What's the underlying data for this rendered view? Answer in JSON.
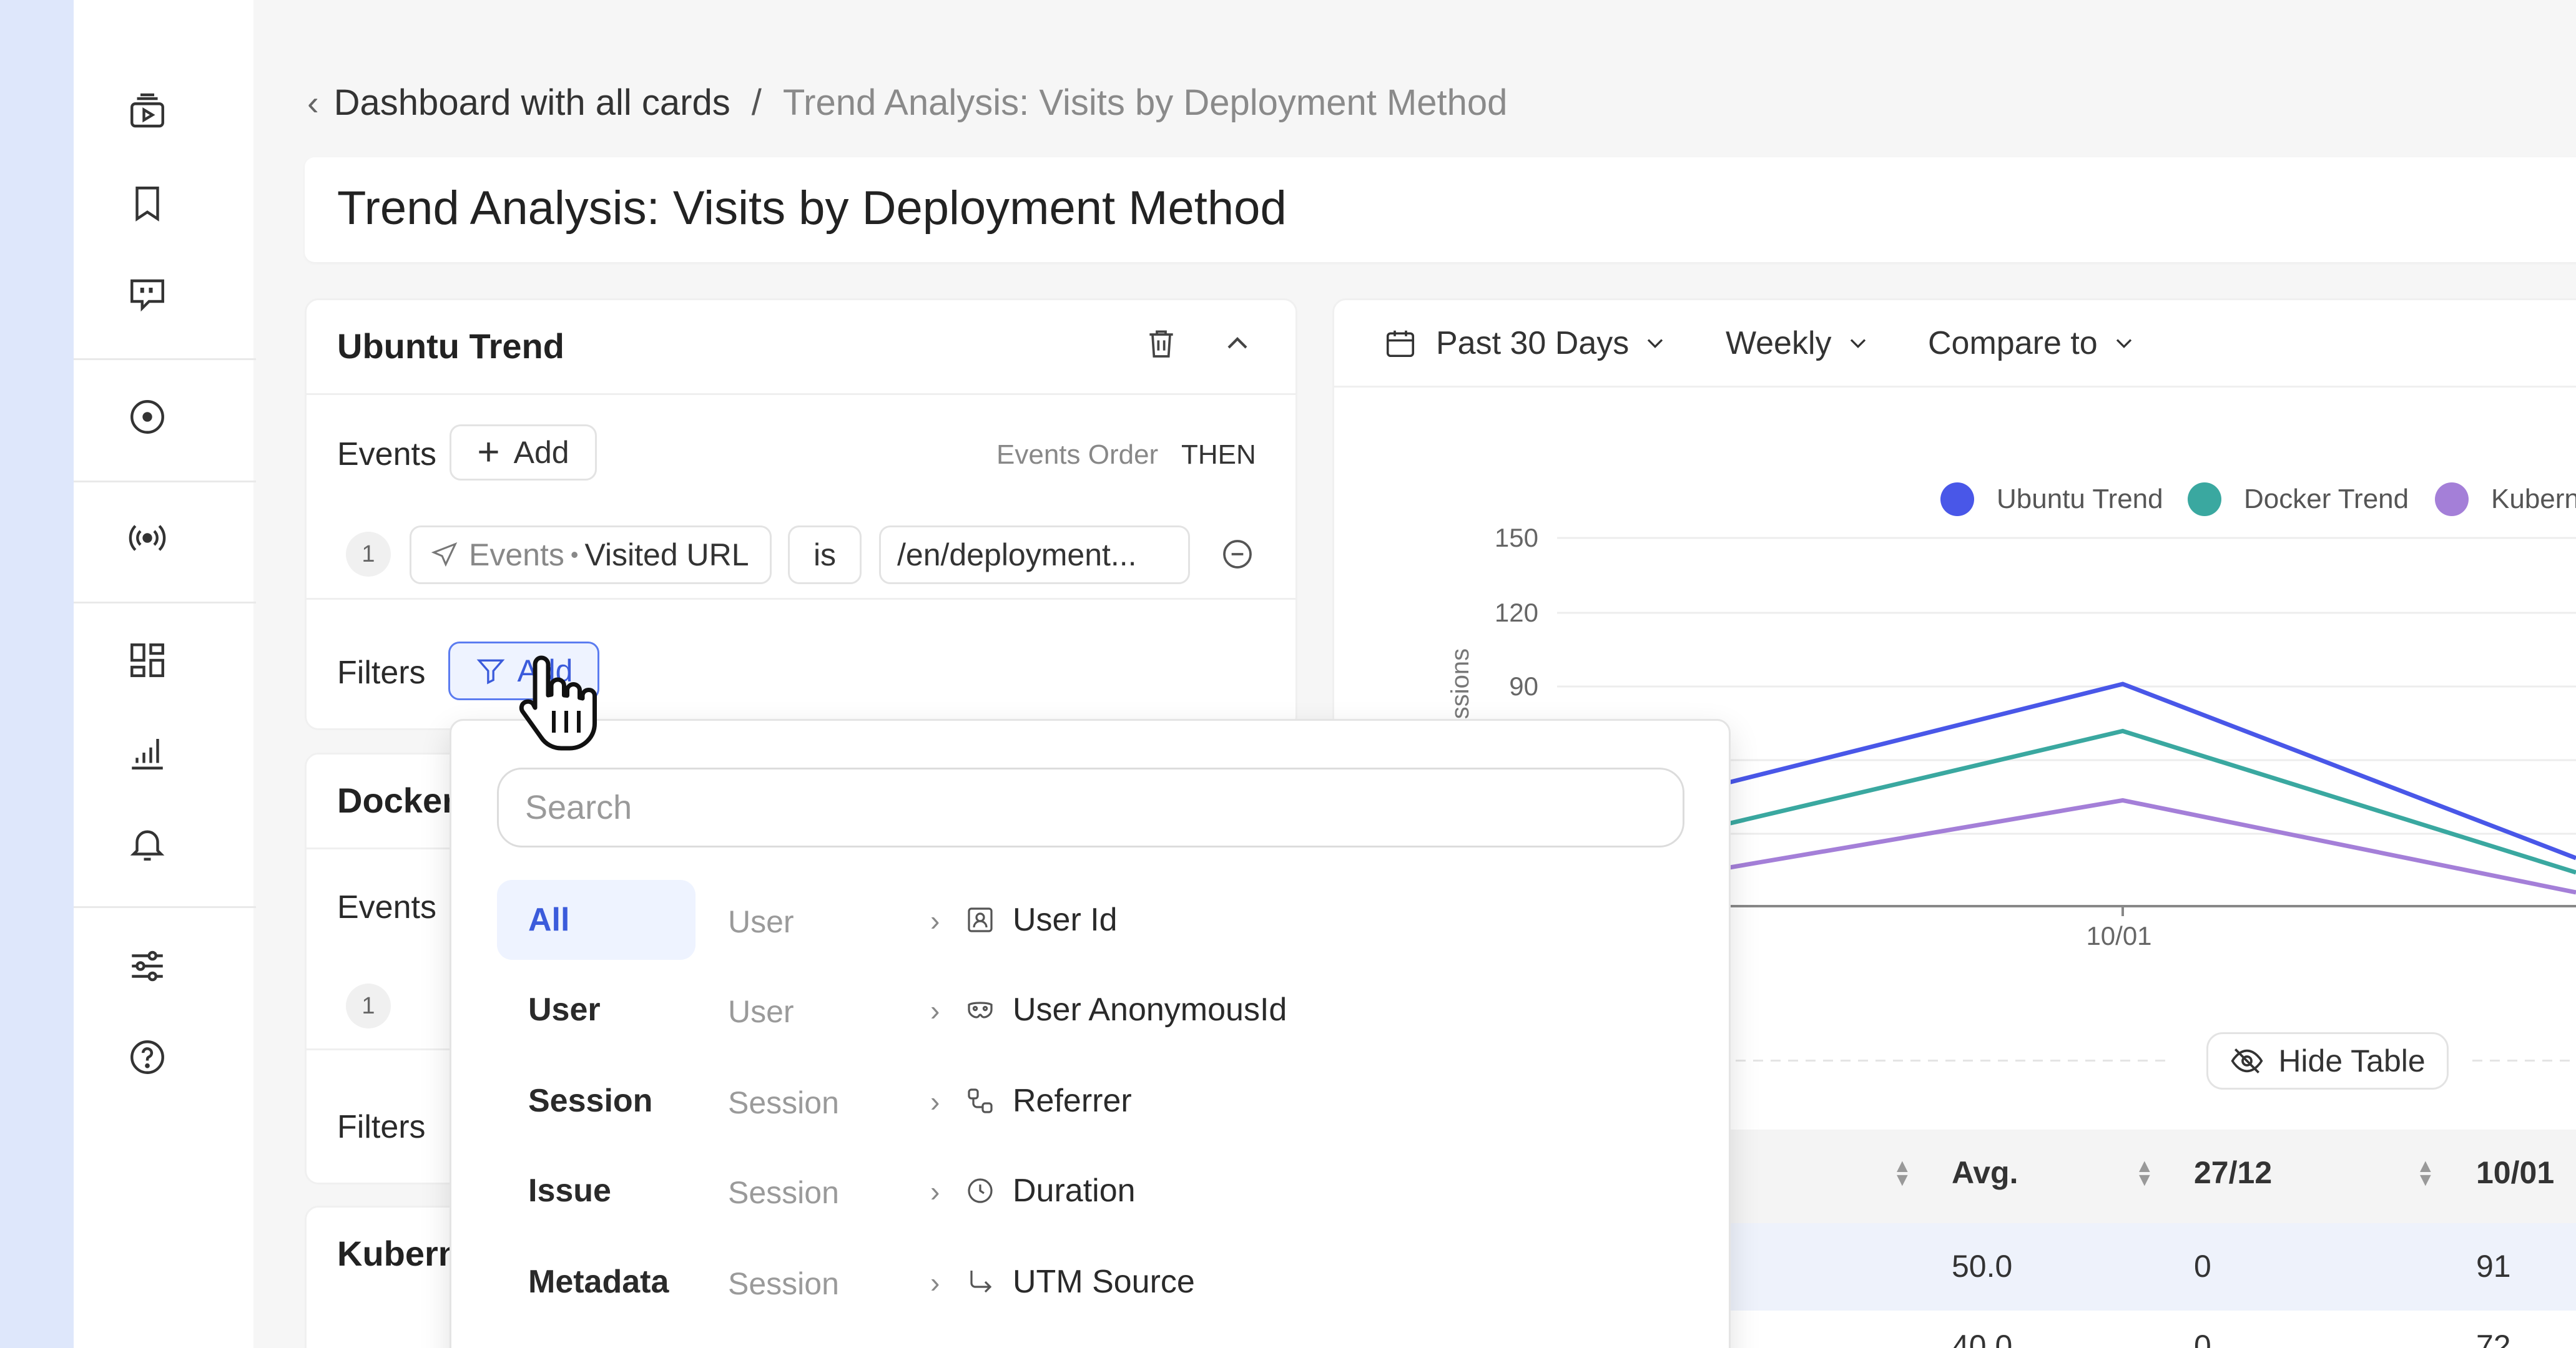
{
  "breadcrumb": {
    "parent": "Dashboard with all cards",
    "separator": "/",
    "current": "Trend Analysis: Visits by Deployment Method"
  },
  "page_title": "Trend Analysis: Visits by Deployment Method",
  "series_cards": [
    {
      "name": "Ubuntu Trend",
      "events_label": "Events",
      "add_label": "Add",
      "events_order_label": "Events Order",
      "events_order_value": "THEN",
      "event_row": {
        "index": "1",
        "source": "Events",
        "property": "Visited URL",
        "operator": "is",
        "value": "/en/deployment..."
      },
      "filters_label": "Filters",
      "filters_add_label": "Add"
    },
    {
      "name": "Docker",
      "events_label": "Events",
      "index": "1",
      "filters_label": "Filters"
    },
    {
      "name": "Kubern"
    }
  ],
  "chart_toolbar": {
    "date_range": "Past 30 Days",
    "granularity": "Weekly",
    "compare": "Compare to"
  },
  "chart_data": {
    "type": "line",
    "ylabel": "Sessions",
    "yticks": [
      "150",
      "120",
      "90"
    ],
    "x_visible_tick": "10/01",
    "series": [
      {
        "name": "Ubuntu Trend",
        "color": "#4957e8",
        "peak_value": 91
      },
      {
        "name": "Docker Trend",
        "color": "#3aa8a0",
        "peak_value": 72
      },
      {
        "name": "Kubern",
        "color": "#a47fd8",
        "peak_value": 44
      }
    ]
  },
  "hide_table_label": "Hide Table",
  "table": {
    "headers": [
      "Avg.",
      "27/12",
      "10/01"
    ],
    "rows": [
      [
        "50.0",
        "0",
        "91"
      ],
      [
        "40.0",
        "0",
        "72"
      ]
    ]
  },
  "filter_dropdown": {
    "search_placeholder": "Search",
    "categories": [
      "All",
      "User",
      "Session",
      "Issue",
      "Metadata"
    ],
    "active_category": "All",
    "properties": [
      {
        "group": "User",
        "name": "User Id",
        "icon": "user-id-icon"
      },
      {
        "group": "User",
        "name": "User AnonymousId",
        "icon": "mask-icon"
      },
      {
        "group": "Session",
        "name": "Referrer",
        "icon": "referrer-icon"
      },
      {
        "group": "Session",
        "name": "Duration",
        "icon": "clock-icon"
      },
      {
        "group": "Session",
        "name": "UTM Source",
        "icon": "arrow-corner-icon"
      }
    ]
  },
  "colors": {
    "accent": "#3b5bdb",
    "sidebar_stripe": "#dee7fb"
  }
}
